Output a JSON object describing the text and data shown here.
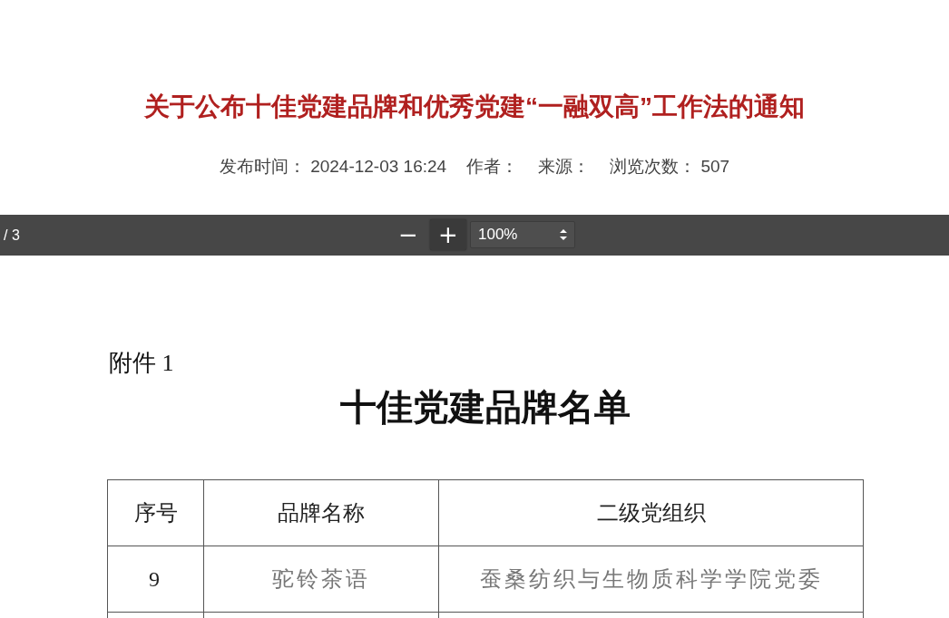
{
  "article": {
    "title": "关于公布十佳党建品牌和优秀党建“一融双高”工作法的通知",
    "meta": [
      {
        "label": "发布时间：",
        "value": "2024-12-03 16:24"
      },
      {
        "label": "作者："
      },
      {
        "label": "来源："
      },
      {
        "label": "浏览次数：",
        "value": "507"
      }
    ]
  },
  "pdf_toolbar": {
    "page_count": "/ 3",
    "zoom_out": "−",
    "zoom_in": "+",
    "zoom": "100%"
  },
  "document": {
    "attachment_label": "附件 1",
    "heading": "十佳党建品牌名单",
    "table": {
      "columns": [
        "序号",
        "品牌名称",
        "二级党组织"
      ],
      "rows": [
        [
          "9",
          "驼铃茶语",
          "蚕桑纺织与生物质科学学院党委"
        ]
      ]
    }
  }
}
